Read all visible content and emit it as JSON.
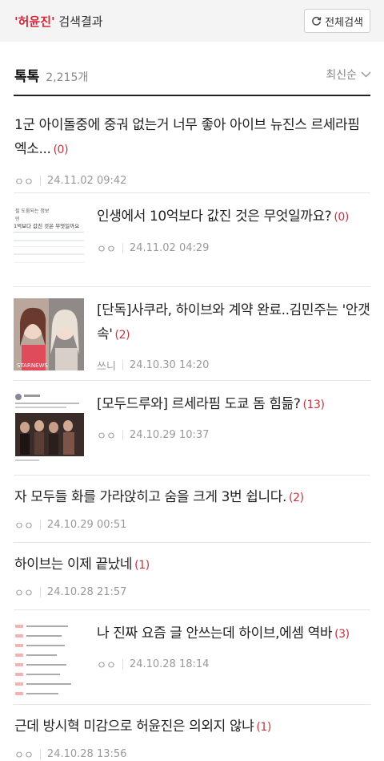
{
  "header": {
    "query": "'허윤진'",
    "suffix": " 검색결과",
    "full_search_label": "전체검색"
  },
  "section": {
    "title": "톡톡",
    "count": "2,215개",
    "sort_label": "최신순"
  },
  "posts": [
    {
      "title": "1군 아이돌중에 중궈 없는거 너무 좋아 아이브 뉴진스 르세라핌 엑소...",
      "count": "(0)",
      "author": "ㅇㅇ",
      "date": "24.11.02 09:42"
    },
    {
      "title": "인생에서 10억보다 값진 것은 무엇일까요?",
      "count": "(0)",
      "author": "ㅇㅇ",
      "date": "24.11.02 04:29"
    },
    {
      "title": "[단독]사쿠라, 하이브와 계약 완료..김민주는 '안갯속'",
      "count": "(2)",
      "author": "쓰니",
      "date": "24.10.30 14:20"
    },
    {
      "title": "[모두드루와] 르세라핌 도쿄 돔 힘듦?",
      "count": "(13)",
      "author": "ㅇㅇ",
      "date": "24.10.29 10:37"
    },
    {
      "title": "자 모두들 화를 가라앉히고 숨을 크게 3번 쉽니다.",
      "count": "(2)",
      "author": "ㅇㅇ",
      "date": "24.10.29 00:51"
    },
    {
      "title": "하이브는 이제 끝났네",
      "count": "(1)",
      "author": "ㅇㅇ",
      "date": "24.10.28 21:57"
    },
    {
      "title": "나 진짜 요즘 글 안쓰는데 하이브,에셈 역바",
      "count": "(3)",
      "author": "ㅇㅇ",
      "date": "24.10.28 18:14"
    },
    {
      "title": "근데 방시혁 미감으로 허윤진은 의외지 않냐",
      "count": "(1)",
      "author": "ㅇㅇ",
      "date": "24.10.28 13:56"
    }
  ],
  "thumbs": {
    "t2_line1": "될 도움되는 정보",
    "t2_line2": "1억보다 값진 것은 무엇일까요",
    "t3_watermark": "STARNEWS"
  }
}
